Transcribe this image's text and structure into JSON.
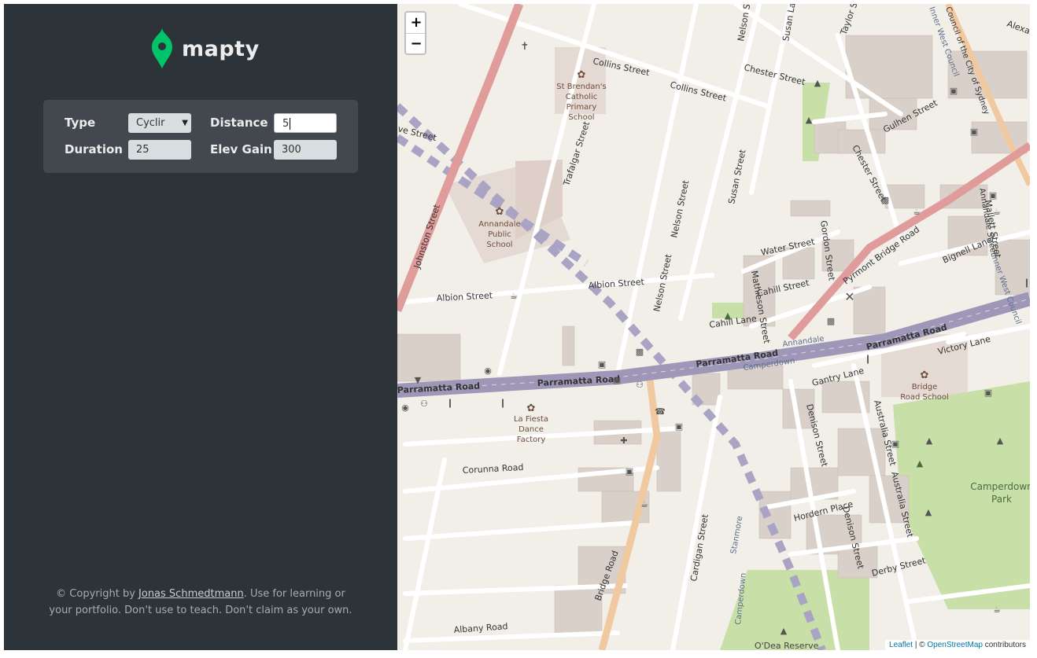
{
  "brand": {
    "name": "mapty",
    "accent": "#00c46a"
  },
  "form": {
    "type_label": "Type",
    "type_value": "Cyclir",
    "distance_label": "Distance",
    "distance_value": "5",
    "duration_label": "Duration",
    "duration_value": "25",
    "elev_label": "Elev Gain",
    "elev_value": "300"
  },
  "footer": {
    "prefix": "© Copyright by ",
    "author": "Jonas Schmedtmann",
    "suffix": ". Use for learning or your portfolio. Don't use to teach. Don't claim as your own."
  },
  "map": {
    "zoom_in": "+",
    "zoom_out": "−",
    "attribution": {
      "leaflet": "Leaflet",
      "sep": " | © ",
      "osm": "OpenStreetMap",
      "tail": " contributors"
    },
    "labels": {
      "collins1": "Collins Street",
      "collins2": "Collins Street",
      "chester1": "Chester Street",
      "chester2": "Chester Street",
      "stbrendans": [
        "St Brendan's",
        "Catholic",
        "Primary",
        "School"
      ],
      "trafalgar": "Trafalgar Street",
      "johnston": "Johnston Street",
      "annandale_school": [
        "Annandale",
        "Public",
        "School"
      ],
      "nelson1": "Nelson Street",
      "nelson2": "Nelson Street",
      "nelson3": "Nelson Street",
      "susan1": "Susan Street",
      "susan2": "Susan Lane",
      "gulhen": "Gulhen Street",
      "albion1": "Albion Street",
      "albion2": "Albion Street",
      "water": "Water Street",
      "gordon": "Gordon Street",
      "pyrmont": "Pyrmont Bridge Road",
      "mathieson": "Mathieson Street",
      "cahill_st": "Cahill Street",
      "cahill_ln": "Cahill Lane",
      "parramatta1": "Parramatta Road",
      "parramatta2": "Parramatta Road",
      "parramatta3": "Parramatta Road",
      "parramatta4": "Parramatta Road",
      "annandale": "Annandale",
      "camperdown": "Camperdown",
      "victory": "Victory Lane",
      "gantry": "Gantry Lane",
      "bignell": "Bignell Lane",
      "bridge_school": [
        "Bridge",
        "Road School"
      ],
      "lafiesta": [
        "La Fiesta",
        "Dance",
        "Factory"
      ],
      "corunna": "Corunna Road",
      "denison1": "Denison Street",
      "denison2": "Denison Street",
      "australia1": "Australia Street",
      "australia2": "Australia Street",
      "hordern": "Hordern Place",
      "derby": "Derby Street",
      "cardigan": "Cardigan Street",
      "stanmore": "Stanmore",
      "camperdown2": "Camperdown",
      "bridge_rd": "Bridge Road",
      "albany": "Albany Road",
      "camperdown_park": [
        "Camperdown",
        "Park"
      ],
      "oldea": "O'Dea Reserve",
      "mallett": "Mallett Street",
      "annandale_st": "Annandale Street",
      "council": "Council of the City of Sydney",
      "inner_west1": "Inner West Council",
      "inner_west2": "Inner West Council",
      "alexandra": "Alexandra",
      "taylor": "Taylor St",
      "eve": "ve Street"
    }
  }
}
